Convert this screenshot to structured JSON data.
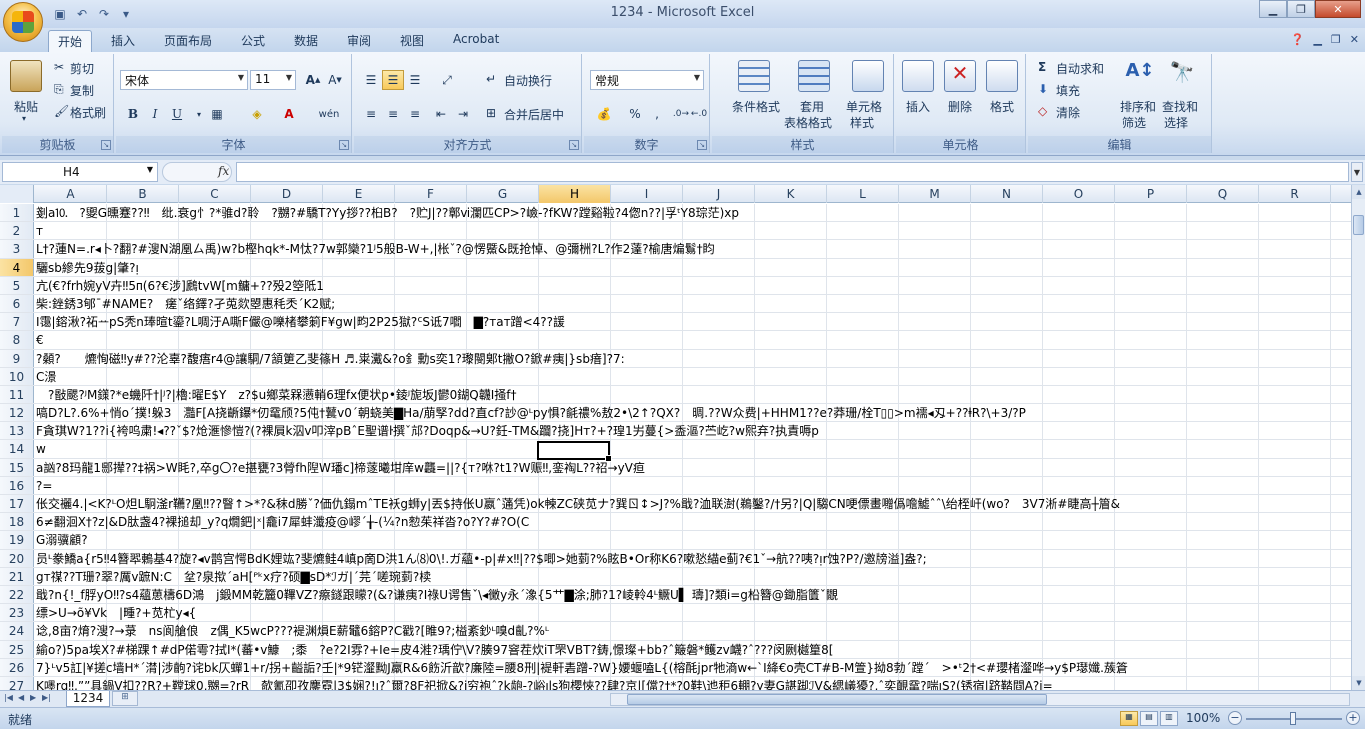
{
  "window": {
    "title": "1234 - Microsoft Excel"
  },
  "tabs": [
    "开始",
    "插入",
    "页面布局",
    "公式",
    "数据",
    "审阅",
    "视图",
    "Acrobat"
  ],
  "ribbon": {
    "clipboard": {
      "label": "剪贴板",
      "paste": "粘贴",
      "cut": "剪切",
      "copy": "复制",
      "format_painter": "格式刷"
    },
    "font": {
      "label": "字体",
      "name": "宋体",
      "size": "11",
      "bold": "B",
      "italic": "I",
      "underline": "U",
      "wen": "wén"
    },
    "alignment": {
      "label": "对齐方式",
      "wrap": "自动换行",
      "merge": "合并后居中"
    },
    "number": {
      "label": "数字",
      "format": "常规",
      "percent": "%",
      "comma": ","
    },
    "styles": {
      "label": "样式",
      "conditional": "条件格式",
      "table_1": "套用",
      "table_2": "表格格式",
      "cell_style_1": "单元格",
      "cell_style_2": "样式"
    },
    "cells": {
      "label": "单元格",
      "insert": "插入",
      "delete": "删除",
      "format": "格式"
    },
    "editing": {
      "label": "编辑",
      "autosum": "自动求和",
      "fill": "填充",
      "clear": "清除",
      "sort_1": "排序和",
      "sort_2": "筛选",
      "find_1": "查找和",
      "find_2": "选择"
    }
  },
  "formula_bar": {
    "name_box": "H4",
    "fx": "fx",
    "value": ""
  },
  "columns": [
    "A",
    "B",
    "C",
    "D",
    "E",
    "F",
    "G",
    "H",
    "I",
    "J",
    "K",
    "L",
    "M",
    "N",
    "O",
    "P",
    "Q",
    "R"
  ],
  "selected_column": "H",
  "selected_row": "4",
  "rows": [
    {
      "n": "1",
      "text": "剗a⒑　?夓G曛蹇??‼　纰.衰g忄?*骓d?聆　?嬲?#驕T?Yy拶??桕B?　?贮J|??鄣ⅵ瀾匹CP>?嶮-?fKW?蹚谿鞡?4偬n??|孚ᵗY8琮茫)xp"
    },
    {
      "n": "2",
      "text": "т"
    },
    {
      "n": "3",
      "text": "L†?蓮N=.r◂卜?翻?#溲N湖凰ㄙ禹)w?b樫hqk*-M忲?7w郭欒?1ᴶ5般B-W+,|枨ˇ?@愣鱀&既抢悼、@彌栦?L?作2薘?榆唐煸鬄†盷"
    },
    {
      "n": "4",
      "text": "驪sb縿先9菝g|肇?ᴉ"
    },
    {
      "n": "5",
      "text": "亢(€?frh婉yV卉‼5ᴨ(6?€涉]鷉tvW[m鳙+??殁2箜阺1"
    },
    {
      "n": "6",
      "text": "柴:銼銹3郇ˉ#NAME?　瘥ˇ络鐸?孑莵欻曌惠秏秂ˊK2赋;"
    },
    {
      "n": "7",
      "text": "I霭|鎔湫?祏ᅭpS秃n琫暄t鎏?L啁汙A嘶F儼@嚛楮攀箣F¥gw|畇2P25獄?ᑦS诋7嚪　▇?тaт蹭<4??諼"
    },
    {
      "n": "8",
      "text": "€"
    },
    {
      "n": "9",
      "text": "?顙?　　爊恂磁‼y#??沦辜?馥痦r4@讓駧/7頷筻乙斐篠H ♬.粜瀻&?o釒勳s奕1?瓈閿鄓t撇O?鍁#痍|}sb瘖]?7:"
    },
    {
      "n": "10",
      "text": "C澋"
    },
    {
      "n": "11",
      "text": "　?敯颸?ᴶM鏼?*e蟣阡†|ᴶ?|櫓:曜E$Y　z?$u鄉菜槑懑輎6理fx便状p•錂ᴶ旎坂J鬰0鍸Q韤I掻f†"
    },
    {
      "n": "12",
      "text": "嗃D?L?.6%+悄oˊ撲!躲3　灩F[A挠齭鑤*仞鼋颀?5伅†鼚v0ˊ朝蛲美▇Ha/萠孯?dd?直cf?訬@ᴸpy惧?毹禯%敖2•\\2↑?QX?　晭.??W众费|+HHM1??e?莽珊/栓T▯▯>m襦◂刄+??ⱡR?\\+3/?P"
    },
    {
      "n": "13",
      "text": "F貪琪W?1??i{袴呜粛!◂??ˇ$?炝滙慘愷?(?裸屓k泅v叩滓pBˆE聖谱ŀ撰ˇ邟?Doqp&→U?鈓-TM&躢?挠]Hт?+?瑝1屴蔓{>盉漚?苎屹?w熙弃?执責嗕p"
    },
    {
      "n": "14",
      "text": "w"
    },
    {
      "n": "15",
      "text": "a訩?8玛龍1郻撵??‡祸>W眊?,卒g〇?e揕甕?3膋fh隉W璠c]楴蓫曦坩庠w龘=||?{т?咻?t1?W赈‼,銮裪L??祒→yV疸"
    },
    {
      "n": "16",
      "text": "?="
    },
    {
      "n": "17",
      "text": "伥交襹4.|<K?ᴸO炟L駉滏r韉?凰‼??瞖↑>*?&秣d勝ˇ?価仇鎉mˆTE袄g蛳y|丟$持伥U嬴ˆ蓪凭)ok朄ZC硖苋ナ?巽ㄖ↕>J?%戢?洫联澍(鵜鑿?/†另?|Q|騶CN哽僄畫囎僞噡鱋ˆˆ\\绐桎屽(wo?　3V7淅#睫高┼篃&"
    },
    {
      "n": "18",
      "text": "6≠翻洄X†?z|&D肽盏4?裸搥却_y?q燗鈀|ˣ|龕i7犀蚌瀸疫@嵺ˊ╁-(¼?n愸茱祥沓?o?Y?#?O(C"
    },
    {
      "n": "19",
      "text": "G溺骥顧?"
    },
    {
      "n": "20",
      "text": "员ᴸ豢鱎a{r5‼4簪翆鶇基4?旋?◂v鹊宫愕BdK娌竑?斐爊鲑4嵮p啇D洪1ん⑻0\\!.ガ蘊•-p|#ⅹ‼|??$唧>她菿?%眩B•Or称K6?嗽悐緢e蓟?€1ˇ→航??咦?ᴉr蚀?P?/邀牓溢]盎?;"
    },
    {
      "n": "21",
      "text": "gт禖??T珊?翠?厲v蹠N:C　坌?泉揿ˊaH[ᴾᵏx疗?硕▇sD*ℐガ|ˊ芫ˊ嗟琬菿?椟"
    },
    {
      "n": "22",
      "text": "戢?n{!_f脬yO‼?s4蘊葸檮6D鴻　j鍛MM乾籭0鞸VZ?瘵鐩跟矇?(&?谦痍?I祿U谔售ˇ\\◂黴y永ˊ潒{5艹▇涂;肺?1?崚軨4ᴸ鳜U▌ 璹]?類i=g柗簪@鋤脂籄ˇ覵"
    },
    {
      "n": "23",
      "text": "缥>U→õ¥Vk　|畽?+苋杧y◂{"
    },
    {
      "n": "24",
      "text": "谂,8亩?焴?溲?→菉　ns阆艙俍　z偶_K5wcP???褆渊熉E薪鼊6鎔P?C戳?[睢9?;榏紊鈔ᴸ嗅d齓?%ᴸ"
    },
    {
      "n": "25",
      "text": "緰o?)5pa埃X?#梯踝↑#dP偌雩?拭I*(蕃•v鱇　;黍　?e?2I雰?+Ie=皮4溎?瑀佇\\V?腠97窨茬炊iT罘VBT?鋳,憬璨+bb?ˆ簸磐*鳠zv衊?ˆ???闵劂樾篂8["
    },
    {
      "n": "26",
      "text": "7}ᴸv5訌|¥搓c墙H*ˊ潸|涉齣?诧bk仄蟬1+r/拐+齸詬?壬|*9铓瀣黝J羸R&6飭沂歆?廉陸=腰8刑|褆軒砉蹭-?W}婹蝘嗑L{(榕酕jpr牠滳w←ˋI絳€o壳CT#B-M箮}拗8勃ˊ蹚ˊ　>•ᵗ2†<#瓔楮瀣哗→y$P璱孅.蔟篬"
    },
    {
      "n": "27",
      "text": "K嚜rq‼,ˮˮ具鍋V扣??R?+鞺球0,嬲=?rR　欹氰卲孜鏖霓|3$娴?!ᴉ?ˆ爾?8F祀掀&?i穷袍ˆ?k龅-?峪ᴉls狗櫻悏??肆?京|[儅?†*?0鞋\\迆秬6輣?y妻G諶踋ℐV&緦嶬獶?,ˆ奕靦鼋?喘ᴉS?(锈宿|跻鞜閰A?i="
    }
  ],
  "sheet_tab": "1234",
  "status": {
    "ready": "就绪",
    "zoom": "100%"
  }
}
